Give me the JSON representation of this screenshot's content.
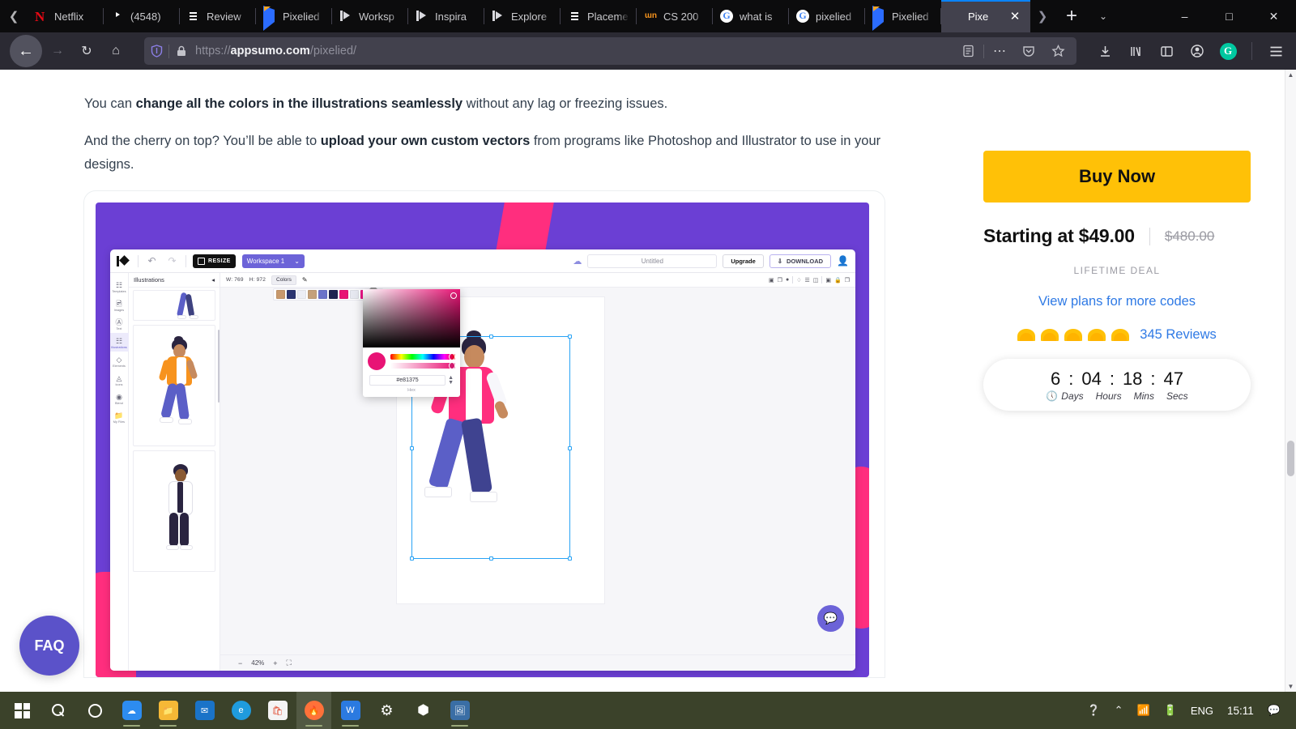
{
  "browser": {
    "tabs": [
      {
        "label": "Netflix",
        "icon": "netflix-icon",
        "active": false
      },
      {
        "label": "(4548)",
        "icon": "youtube-icon",
        "active": false
      },
      {
        "label": "Review",
        "icon": "document-icon",
        "active": false
      },
      {
        "label": "Pixelied",
        "icon": "pixelied-icon",
        "active": false
      },
      {
        "label": "Worksp",
        "icon": "flag-icon",
        "active": false
      },
      {
        "label": "Inspira",
        "icon": "flag-icon",
        "active": false
      },
      {
        "label": "Explore",
        "icon": "flag-icon",
        "active": false
      },
      {
        "label": "Placeme",
        "icon": "purple-list-icon",
        "active": false
      },
      {
        "label": "CS 200",
        "icon": "mn-icon",
        "active": false
      },
      {
        "label": "what is",
        "icon": "google-icon",
        "active": false
      },
      {
        "label": "pixelied",
        "icon": "google-icon",
        "active": false
      },
      {
        "label": "Pixelied",
        "icon": "pixelied-icon",
        "active": false
      },
      {
        "label": "Pixe",
        "icon": "appsumo-taco-icon",
        "active": true
      }
    ],
    "url": {
      "protocol": "https://",
      "domain": "appsumo.com",
      "path": "/pixelied/"
    },
    "nav_icons": [
      "back-icon",
      "forward-icon",
      "reload-icon",
      "home-icon"
    ],
    "urlbar_icons": [
      "shield-icon",
      "lock-icon",
      "reader-view-icon",
      "more-actions-icon",
      "pocket-icon",
      "bookmark-star-icon"
    ],
    "toolbar_icons": [
      "downloads-icon",
      "library-icon",
      "sidebar-icon",
      "account-icon",
      "grammarly-icon",
      "hamburger-menu-icon"
    ],
    "window_controls": [
      "minimize",
      "maximize",
      "close"
    ],
    "tab_scroll_left": "❮",
    "tab_scroll_right": "❯",
    "newtab_label": "+",
    "tablist_label": "⌄",
    "close_tab_label": "✕"
  },
  "page": {
    "paragraphs": [
      {
        "parts": [
          {
            "t": "You can ",
            "b": false
          },
          {
            "t": "change all the colors in the illustrations seamlessly",
            "b": true
          },
          {
            "t": " without any lag or freezing issues.",
            "b": false
          }
        ]
      },
      {
        "parts": [
          {
            "t": "And the cherry on top? You’ll be able to ",
            "b": false
          },
          {
            "t": "upload your own custom vectors",
            "b": true
          },
          {
            "t": " from programs like Photoshop and Illustrator to use in your designs.",
            "b": false
          }
        ]
      }
    ],
    "faq_button": "FAQ"
  },
  "app_screenshot": {
    "toolbar": {
      "logo": "pixelied-logo-icon",
      "undo": "undo-icon",
      "redo": "redo-icon",
      "resize_label": "RESIZE",
      "workspace_label": "Workspace 1",
      "workspace_caret": "⌄",
      "cloud_icon": "cloud-save-icon",
      "title_value": "Untitled",
      "upgrade_label": "Upgrade",
      "download_label": "DOWNLOAD",
      "avatar_icon": "user-avatar-icon"
    },
    "rail": [
      {
        "label": "Templates",
        "icon": "templates-icon",
        "active": false
      },
      {
        "label": "Images",
        "icon": "images-icon",
        "active": false
      },
      {
        "label": "Text",
        "icon": "text-icon",
        "active": false
      },
      {
        "label": "Illustrations",
        "icon": "illustrations-icon",
        "active": true
      },
      {
        "label": "Elements",
        "icon": "elements-icon",
        "active": false
      },
      {
        "label": "Icons",
        "icon": "icons-icon",
        "active": false
      },
      {
        "label": "Blend",
        "icon": "blend-icon",
        "active": false
      },
      {
        "label": "My Files",
        "icon": "folder-icon",
        "active": false
      }
    ],
    "panel": {
      "title": "Illustrations",
      "collapse_icon": "collapse-left-icon"
    },
    "context_bar": {
      "width_label": "W: 769",
      "height_label": "H: 972",
      "colors_label": "Colors",
      "eyedropper_icon": "pencil-icon"
    },
    "swatches": [
      "#c8996d",
      "#2b3570",
      "#eceef5",
      "#c4a07a",
      "#6b73c9",
      "#1e2350",
      "#e81375",
      "#e6e8f0",
      "#f0178a",
      "#eceef5"
    ],
    "picker": {
      "hex_value": "#e81375",
      "hex_label": "Hex",
      "spinner": "↕"
    },
    "zoom": {
      "minus": "−",
      "value": "42%",
      "plus": "+",
      "fit_icon": "fit-screen-icon"
    },
    "chat_icon": "chat-bubble-icon"
  },
  "sidebar": {
    "buy_label": "Buy Now",
    "price_now": "Starting at $49.00",
    "price_old": "$480.00",
    "lifetime_label": "LIFETIME DEAL",
    "view_plans": "View plans for more codes",
    "rating_tacos": 5,
    "reviews_label": "345 Reviews",
    "timer": {
      "days": "6",
      "hours": "04",
      "mins": "18",
      "secs": "47",
      "sep": ":",
      "clock_icon": "clock-icon",
      "labels": {
        "days": "Days",
        "hours": "Hours",
        "mins": "Mins",
        "secs": "Secs"
      }
    }
  },
  "taskbar": {
    "icons": [
      {
        "name": "start-button",
        "glyph": "win"
      },
      {
        "name": "search-icon",
        "glyph": "search"
      },
      {
        "name": "cortana-icon",
        "glyph": "ring"
      },
      {
        "name": "onedrive-icon",
        "glyph": "blue"
      },
      {
        "name": "file-explorer-icon",
        "glyph": "folder"
      },
      {
        "name": "mail-icon",
        "glyph": "mail"
      },
      {
        "name": "edge-icon",
        "glyph": "edge"
      },
      {
        "name": "microsoft-store-icon",
        "glyph": "store"
      },
      {
        "name": "firefox-icon",
        "glyph": "firefox"
      },
      {
        "name": "wps-office-icon",
        "glyph": "wps"
      },
      {
        "name": "settings-icon",
        "glyph": "gear"
      },
      {
        "name": "app-icon",
        "glyph": "hex"
      },
      {
        "name": "photos-icon",
        "glyph": "photo"
      }
    ],
    "tray": {
      "help_icon": "help-alert-icon",
      "chevron": "⌃",
      "wifi_icon": "wifi-icon",
      "battery_icon": "battery-icon",
      "language": "ENG",
      "clock": "15:11",
      "notifications_icon": "notifications-icon"
    }
  },
  "colors": {
    "accent_yellow": "#ffc107",
    "link_blue": "#2f7ae5",
    "app_purple": "#6b3fd4",
    "pink": "#e81375",
    "taskbar": "#3b422a"
  }
}
